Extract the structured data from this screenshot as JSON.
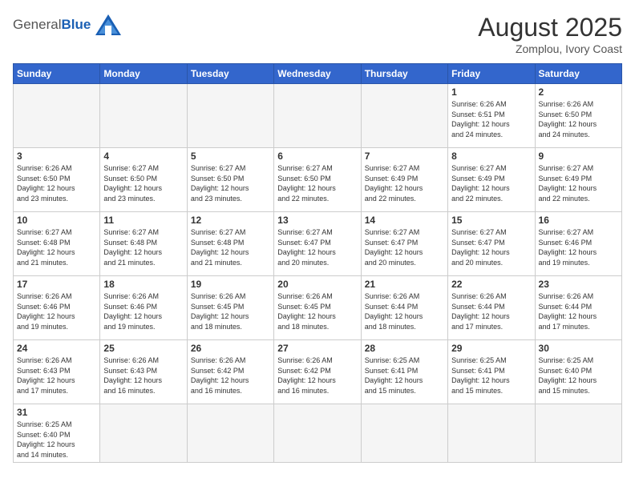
{
  "header": {
    "logo_general": "General",
    "logo_blue": "Blue",
    "title": "August 2025",
    "subtitle": "Zomplou, Ivory Coast"
  },
  "weekdays": [
    "Sunday",
    "Monday",
    "Tuesday",
    "Wednesday",
    "Thursday",
    "Friday",
    "Saturday"
  ],
  "weeks": [
    [
      {
        "day": "",
        "info": ""
      },
      {
        "day": "",
        "info": ""
      },
      {
        "day": "",
        "info": ""
      },
      {
        "day": "",
        "info": ""
      },
      {
        "day": "",
        "info": ""
      },
      {
        "day": "1",
        "info": "Sunrise: 6:26 AM\nSunset: 6:51 PM\nDaylight: 12 hours\nand 24 minutes."
      },
      {
        "day": "2",
        "info": "Sunrise: 6:26 AM\nSunset: 6:50 PM\nDaylight: 12 hours\nand 24 minutes."
      }
    ],
    [
      {
        "day": "3",
        "info": "Sunrise: 6:26 AM\nSunset: 6:50 PM\nDaylight: 12 hours\nand 23 minutes."
      },
      {
        "day": "4",
        "info": "Sunrise: 6:27 AM\nSunset: 6:50 PM\nDaylight: 12 hours\nand 23 minutes."
      },
      {
        "day": "5",
        "info": "Sunrise: 6:27 AM\nSunset: 6:50 PM\nDaylight: 12 hours\nand 23 minutes."
      },
      {
        "day": "6",
        "info": "Sunrise: 6:27 AM\nSunset: 6:50 PM\nDaylight: 12 hours\nand 22 minutes."
      },
      {
        "day": "7",
        "info": "Sunrise: 6:27 AM\nSunset: 6:49 PM\nDaylight: 12 hours\nand 22 minutes."
      },
      {
        "day": "8",
        "info": "Sunrise: 6:27 AM\nSunset: 6:49 PM\nDaylight: 12 hours\nand 22 minutes."
      },
      {
        "day": "9",
        "info": "Sunrise: 6:27 AM\nSunset: 6:49 PM\nDaylight: 12 hours\nand 22 minutes."
      }
    ],
    [
      {
        "day": "10",
        "info": "Sunrise: 6:27 AM\nSunset: 6:48 PM\nDaylight: 12 hours\nand 21 minutes."
      },
      {
        "day": "11",
        "info": "Sunrise: 6:27 AM\nSunset: 6:48 PM\nDaylight: 12 hours\nand 21 minutes."
      },
      {
        "day": "12",
        "info": "Sunrise: 6:27 AM\nSunset: 6:48 PM\nDaylight: 12 hours\nand 21 minutes."
      },
      {
        "day": "13",
        "info": "Sunrise: 6:27 AM\nSunset: 6:47 PM\nDaylight: 12 hours\nand 20 minutes."
      },
      {
        "day": "14",
        "info": "Sunrise: 6:27 AM\nSunset: 6:47 PM\nDaylight: 12 hours\nand 20 minutes."
      },
      {
        "day": "15",
        "info": "Sunrise: 6:27 AM\nSunset: 6:47 PM\nDaylight: 12 hours\nand 20 minutes."
      },
      {
        "day": "16",
        "info": "Sunrise: 6:27 AM\nSunset: 6:46 PM\nDaylight: 12 hours\nand 19 minutes."
      }
    ],
    [
      {
        "day": "17",
        "info": "Sunrise: 6:26 AM\nSunset: 6:46 PM\nDaylight: 12 hours\nand 19 minutes."
      },
      {
        "day": "18",
        "info": "Sunrise: 6:26 AM\nSunset: 6:46 PM\nDaylight: 12 hours\nand 19 minutes."
      },
      {
        "day": "19",
        "info": "Sunrise: 6:26 AM\nSunset: 6:45 PM\nDaylight: 12 hours\nand 18 minutes."
      },
      {
        "day": "20",
        "info": "Sunrise: 6:26 AM\nSunset: 6:45 PM\nDaylight: 12 hours\nand 18 minutes."
      },
      {
        "day": "21",
        "info": "Sunrise: 6:26 AM\nSunset: 6:44 PM\nDaylight: 12 hours\nand 18 minutes."
      },
      {
        "day": "22",
        "info": "Sunrise: 6:26 AM\nSunset: 6:44 PM\nDaylight: 12 hours\nand 17 minutes."
      },
      {
        "day": "23",
        "info": "Sunrise: 6:26 AM\nSunset: 6:44 PM\nDaylight: 12 hours\nand 17 minutes."
      }
    ],
    [
      {
        "day": "24",
        "info": "Sunrise: 6:26 AM\nSunset: 6:43 PM\nDaylight: 12 hours\nand 17 minutes."
      },
      {
        "day": "25",
        "info": "Sunrise: 6:26 AM\nSunset: 6:43 PM\nDaylight: 12 hours\nand 16 minutes."
      },
      {
        "day": "26",
        "info": "Sunrise: 6:26 AM\nSunset: 6:42 PM\nDaylight: 12 hours\nand 16 minutes."
      },
      {
        "day": "27",
        "info": "Sunrise: 6:26 AM\nSunset: 6:42 PM\nDaylight: 12 hours\nand 16 minutes."
      },
      {
        "day": "28",
        "info": "Sunrise: 6:25 AM\nSunset: 6:41 PM\nDaylight: 12 hours\nand 15 minutes."
      },
      {
        "day": "29",
        "info": "Sunrise: 6:25 AM\nSunset: 6:41 PM\nDaylight: 12 hours\nand 15 minutes."
      },
      {
        "day": "30",
        "info": "Sunrise: 6:25 AM\nSunset: 6:40 PM\nDaylight: 12 hours\nand 15 minutes."
      }
    ],
    [
      {
        "day": "31",
        "info": "Sunrise: 6:25 AM\nSunset: 6:40 PM\nDaylight: 12 hours\nand 14 minutes."
      },
      {
        "day": "",
        "info": ""
      },
      {
        "day": "",
        "info": ""
      },
      {
        "day": "",
        "info": ""
      },
      {
        "day": "",
        "info": ""
      },
      {
        "day": "",
        "info": ""
      },
      {
        "day": "",
        "info": ""
      }
    ]
  ]
}
